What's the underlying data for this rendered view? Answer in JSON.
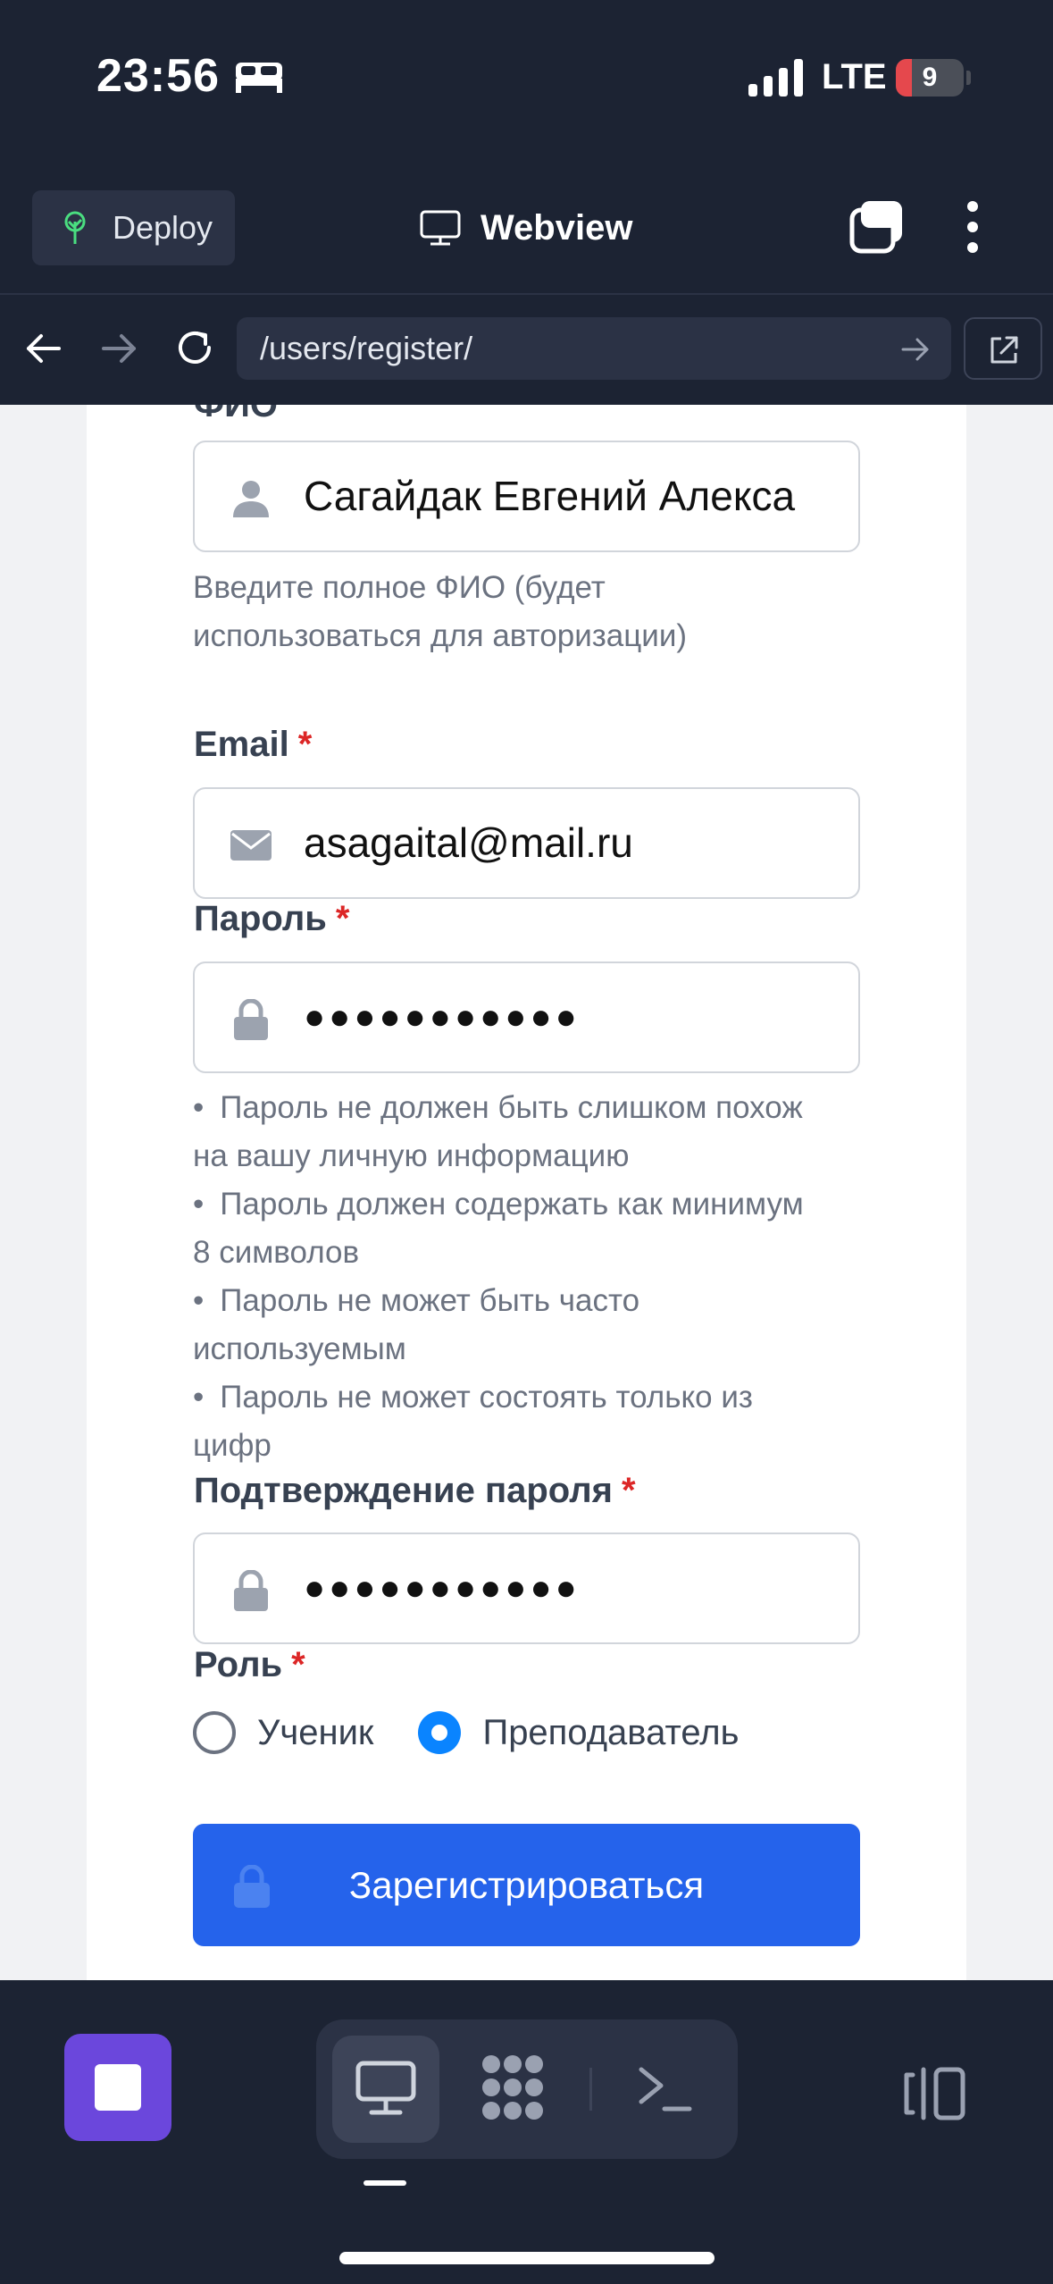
{
  "status_bar": {
    "time": "23:56",
    "network": "LTE",
    "battery": "9",
    "icons": [
      "bed-icon",
      "signal-icon",
      "battery-icon"
    ]
  },
  "top_bar": {
    "deploy_label": "Deploy",
    "title": "Webview",
    "icons": [
      "deploy-tree-icon",
      "monitor-icon",
      "tabs-icon",
      "more-vertical-icon"
    ]
  },
  "url_bar": {
    "url": "/users/register/",
    "icons": [
      "back-arrow-icon",
      "forward-arrow-icon",
      "reload-icon",
      "go-arrow-icon",
      "open-external-icon"
    ]
  },
  "form": {
    "fio_label": "ФИО",
    "fio_value": "Сагайдак Евгений Алекса",
    "fio_help": "Введите полное ФИО (будет использоваться для авторизации)",
    "email_label": "Email",
    "email_value": "asagaital@mail.ru",
    "password_label": "Пароль",
    "password_value": "●●●●●●●●●●●",
    "password_rules": [
      "Пароль не должен быть слишком похож на вашу личную информацию",
      "Пароль должен содержать как минимум 8 символов",
      "Пароль не может быть часто используемым",
      "Пароль не может состоять только из цифр"
    ],
    "confirm_label": "Подтверждение пароля",
    "confirm_value": "●●●●●●●●●●●",
    "role_label": "Роль",
    "role_options": [
      "Ученик",
      "Преподаватель"
    ],
    "role_selected": "Преподаватель",
    "required_mark": "*",
    "submit_label": "Зарегистрироваться"
  },
  "colors": {
    "chrome_bg": "#1c2333",
    "primary": "#2563eb",
    "radio_selected": "#0a84ff",
    "required": "#dc2626",
    "stop_button": "#6b47dc"
  }
}
